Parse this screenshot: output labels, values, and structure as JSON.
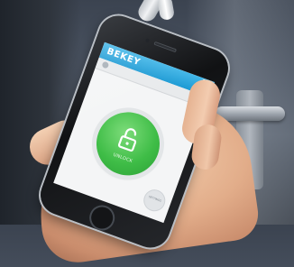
{
  "app": {
    "title": "BEKEY",
    "unlock_label": "UNLOCK",
    "secondary_label": "SETTINGS"
  },
  "icons": {
    "power": "power-icon",
    "lock": "unlocked-padlock-icon"
  },
  "colors": {
    "header": "#1c9ad4",
    "unlock_button": "#3fbd47",
    "screen_background": "#f4f5f6"
  }
}
